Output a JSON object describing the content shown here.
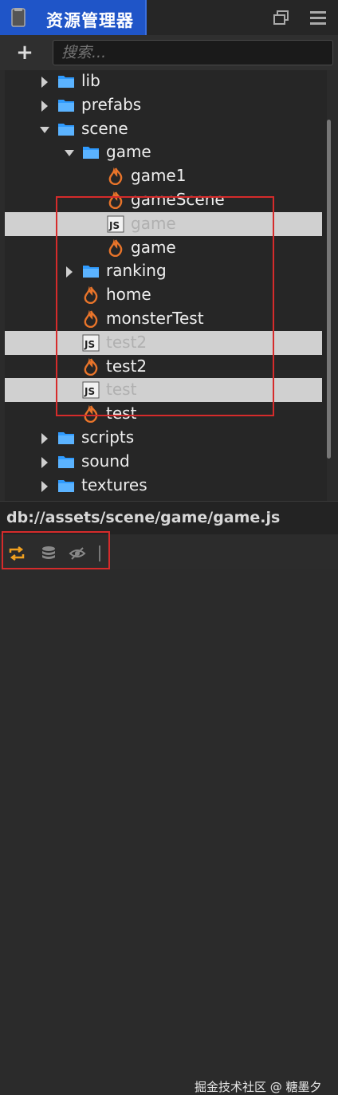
{
  "window": {
    "title": "资源管理器"
  },
  "toolbar": {
    "add_label": "+",
    "search_placeholder": "搜索..."
  },
  "tree": {
    "rows": [
      {
        "label": "lib",
        "kind": "folder",
        "expander": "collapsed",
        "depth": 1,
        "selected": false
      },
      {
        "label": "prefabs",
        "kind": "folder",
        "expander": "collapsed",
        "depth": 1,
        "selected": false
      },
      {
        "label": "scene",
        "kind": "folder",
        "expander": "expanded",
        "depth": 1,
        "selected": false
      },
      {
        "label": "game",
        "kind": "folder",
        "expander": "expanded",
        "depth": 2,
        "selected": false
      },
      {
        "label": "game1",
        "kind": "fire",
        "expander": "none",
        "depth": 3,
        "selected": false
      },
      {
        "label": "gameScene",
        "kind": "fire",
        "expander": "none",
        "depth": 3,
        "selected": false
      },
      {
        "label": "game",
        "kind": "js",
        "expander": "none",
        "depth": 3,
        "selected": true
      },
      {
        "label": "game",
        "kind": "fire",
        "expander": "none",
        "depth": 3,
        "selected": false
      },
      {
        "label": "ranking",
        "kind": "folder",
        "expander": "collapsed",
        "depth": 2,
        "selected": false
      },
      {
        "label": "home",
        "kind": "fire",
        "expander": "none",
        "depth": 2,
        "selected": false
      },
      {
        "label": "monsterTest",
        "kind": "fire",
        "expander": "none",
        "depth": 2,
        "selected": false
      },
      {
        "label": "test2",
        "kind": "js",
        "expander": "none",
        "depth": 2,
        "selected": true
      },
      {
        "label": "test2",
        "kind": "fire",
        "expander": "none",
        "depth": 2,
        "selected": false
      },
      {
        "label": "test",
        "kind": "js",
        "expander": "none",
        "depth": 2,
        "selected": true
      },
      {
        "label": "test",
        "kind": "fire",
        "expander": "none",
        "depth": 2,
        "selected": false
      },
      {
        "label": "scripts",
        "kind": "folder",
        "expander": "collapsed",
        "depth": 1,
        "selected": false
      },
      {
        "label": "sound",
        "kind": "folder",
        "expander": "collapsed",
        "depth": 1,
        "selected": false
      },
      {
        "label": "textures",
        "kind": "folder",
        "expander": "collapsed",
        "depth": 1,
        "selected": false
      }
    ]
  },
  "status": {
    "path": "db://assets/scene/game/game.js"
  },
  "footer": {
    "icons": [
      "sync-icon",
      "database-icon",
      "hidden-icon"
    ],
    "watermark": "掘金技术社区 @ 糖墨夕"
  },
  "colors": {
    "tab_active": "#1f55c8",
    "folder": "#2f9bff",
    "fire": "#e8742a",
    "selection": "#d0d0d0",
    "highlight_box": "#d52b2b"
  }
}
